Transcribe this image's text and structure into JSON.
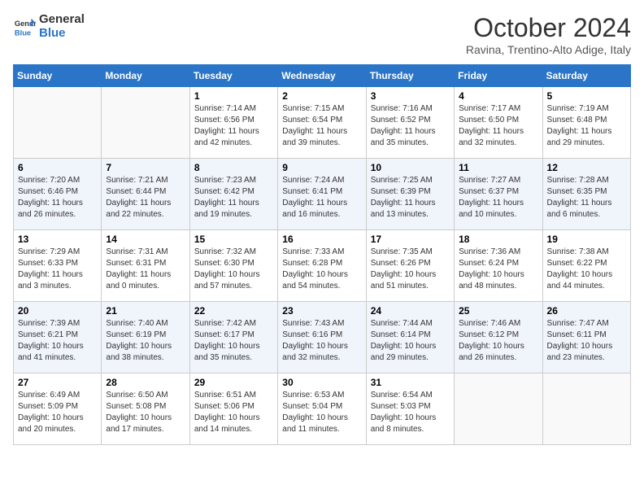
{
  "header": {
    "logo_line1": "General",
    "logo_line2": "Blue",
    "month_title": "October 2024",
    "location": "Ravina, Trentino-Alto Adige, Italy"
  },
  "days_of_week": [
    "Sunday",
    "Monday",
    "Tuesday",
    "Wednesday",
    "Thursday",
    "Friday",
    "Saturday"
  ],
  "weeks": [
    [
      {
        "day": "",
        "sunrise": "",
        "sunset": "",
        "daylight": ""
      },
      {
        "day": "",
        "sunrise": "",
        "sunset": "",
        "daylight": ""
      },
      {
        "day": "1",
        "sunrise": "Sunrise: 7:14 AM",
        "sunset": "Sunset: 6:56 PM",
        "daylight": "Daylight: 11 hours and 42 minutes."
      },
      {
        "day": "2",
        "sunrise": "Sunrise: 7:15 AM",
        "sunset": "Sunset: 6:54 PM",
        "daylight": "Daylight: 11 hours and 39 minutes."
      },
      {
        "day": "3",
        "sunrise": "Sunrise: 7:16 AM",
        "sunset": "Sunset: 6:52 PM",
        "daylight": "Daylight: 11 hours and 35 minutes."
      },
      {
        "day": "4",
        "sunrise": "Sunrise: 7:17 AM",
        "sunset": "Sunset: 6:50 PM",
        "daylight": "Daylight: 11 hours and 32 minutes."
      },
      {
        "day": "5",
        "sunrise": "Sunrise: 7:19 AM",
        "sunset": "Sunset: 6:48 PM",
        "daylight": "Daylight: 11 hours and 29 minutes."
      }
    ],
    [
      {
        "day": "6",
        "sunrise": "Sunrise: 7:20 AM",
        "sunset": "Sunset: 6:46 PM",
        "daylight": "Daylight: 11 hours and 26 minutes."
      },
      {
        "day": "7",
        "sunrise": "Sunrise: 7:21 AM",
        "sunset": "Sunset: 6:44 PM",
        "daylight": "Daylight: 11 hours and 22 minutes."
      },
      {
        "day": "8",
        "sunrise": "Sunrise: 7:23 AM",
        "sunset": "Sunset: 6:42 PM",
        "daylight": "Daylight: 11 hours and 19 minutes."
      },
      {
        "day": "9",
        "sunrise": "Sunrise: 7:24 AM",
        "sunset": "Sunset: 6:41 PM",
        "daylight": "Daylight: 11 hours and 16 minutes."
      },
      {
        "day": "10",
        "sunrise": "Sunrise: 7:25 AM",
        "sunset": "Sunset: 6:39 PM",
        "daylight": "Daylight: 11 hours and 13 minutes."
      },
      {
        "day": "11",
        "sunrise": "Sunrise: 7:27 AM",
        "sunset": "Sunset: 6:37 PM",
        "daylight": "Daylight: 11 hours and 10 minutes."
      },
      {
        "day": "12",
        "sunrise": "Sunrise: 7:28 AM",
        "sunset": "Sunset: 6:35 PM",
        "daylight": "Daylight: 11 hours and 6 minutes."
      }
    ],
    [
      {
        "day": "13",
        "sunrise": "Sunrise: 7:29 AM",
        "sunset": "Sunset: 6:33 PM",
        "daylight": "Daylight: 11 hours and 3 minutes."
      },
      {
        "day": "14",
        "sunrise": "Sunrise: 7:31 AM",
        "sunset": "Sunset: 6:31 PM",
        "daylight": "Daylight: 11 hours and 0 minutes."
      },
      {
        "day": "15",
        "sunrise": "Sunrise: 7:32 AM",
        "sunset": "Sunset: 6:30 PM",
        "daylight": "Daylight: 10 hours and 57 minutes."
      },
      {
        "day": "16",
        "sunrise": "Sunrise: 7:33 AM",
        "sunset": "Sunset: 6:28 PM",
        "daylight": "Daylight: 10 hours and 54 minutes."
      },
      {
        "day": "17",
        "sunrise": "Sunrise: 7:35 AM",
        "sunset": "Sunset: 6:26 PM",
        "daylight": "Daylight: 10 hours and 51 minutes."
      },
      {
        "day": "18",
        "sunrise": "Sunrise: 7:36 AM",
        "sunset": "Sunset: 6:24 PM",
        "daylight": "Daylight: 10 hours and 48 minutes."
      },
      {
        "day": "19",
        "sunrise": "Sunrise: 7:38 AM",
        "sunset": "Sunset: 6:22 PM",
        "daylight": "Daylight: 10 hours and 44 minutes."
      }
    ],
    [
      {
        "day": "20",
        "sunrise": "Sunrise: 7:39 AM",
        "sunset": "Sunset: 6:21 PM",
        "daylight": "Daylight: 10 hours and 41 minutes."
      },
      {
        "day": "21",
        "sunrise": "Sunrise: 7:40 AM",
        "sunset": "Sunset: 6:19 PM",
        "daylight": "Daylight: 10 hours and 38 minutes."
      },
      {
        "day": "22",
        "sunrise": "Sunrise: 7:42 AM",
        "sunset": "Sunset: 6:17 PM",
        "daylight": "Daylight: 10 hours and 35 minutes."
      },
      {
        "day": "23",
        "sunrise": "Sunrise: 7:43 AM",
        "sunset": "Sunset: 6:16 PM",
        "daylight": "Daylight: 10 hours and 32 minutes."
      },
      {
        "day": "24",
        "sunrise": "Sunrise: 7:44 AM",
        "sunset": "Sunset: 6:14 PM",
        "daylight": "Daylight: 10 hours and 29 minutes."
      },
      {
        "day": "25",
        "sunrise": "Sunrise: 7:46 AM",
        "sunset": "Sunset: 6:12 PM",
        "daylight": "Daylight: 10 hours and 26 minutes."
      },
      {
        "day": "26",
        "sunrise": "Sunrise: 7:47 AM",
        "sunset": "Sunset: 6:11 PM",
        "daylight": "Daylight: 10 hours and 23 minutes."
      }
    ],
    [
      {
        "day": "27",
        "sunrise": "Sunrise: 6:49 AM",
        "sunset": "Sunset: 5:09 PM",
        "daylight": "Daylight: 10 hours and 20 minutes."
      },
      {
        "day": "28",
        "sunrise": "Sunrise: 6:50 AM",
        "sunset": "Sunset: 5:08 PM",
        "daylight": "Daylight: 10 hours and 17 minutes."
      },
      {
        "day": "29",
        "sunrise": "Sunrise: 6:51 AM",
        "sunset": "Sunset: 5:06 PM",
        "daylight": "Daylight: 10 hours and 14 minutes."
      },
      {
        "day": "30",
        "sunrise": "Sunrise: 6:53 AM",
        "sunset": "Sunset: 5:04 PM",
        "daylight": "Daylight: 10 hours and 11 minutes."
      },
      {
        "day": "31",
        "sunrise": "Sunrise: 6:54 AM",
        "sunset": "Sunset: 5:03 PM",
        "daylight": "Daylight: 10 hours and 8 minutes."
      },
      {
        "day": "",
        "sunrise": "",
        "sunset": "",
        "daylight": ""
      },
      {
        "day": "",
        "sunrise": "",
        "sunset": "",
        "daylight": ""
      }
    ]
  ]
}
